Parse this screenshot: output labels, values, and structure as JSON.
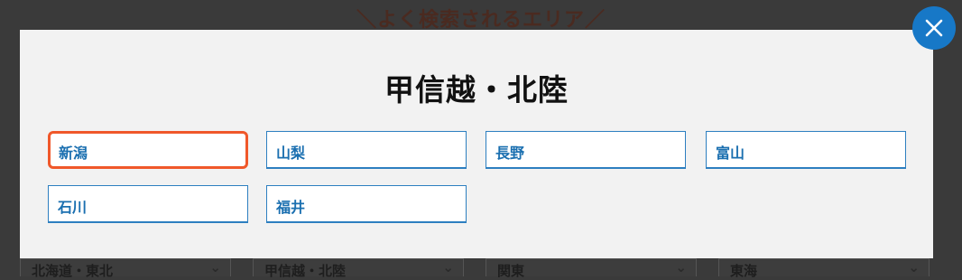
{
  "background": {
    "heading": "＼よく検索されるエリア／",
    "tabs": [
      {
        "label": "北海道・東北"
      },
      {
        "label": "甲信越・北陸"
      },
      {
        "label": "関東"
      },
      {
        "label": "東海"
      }
    ]
  },
  "modal": {
    "title": "甲信越・北陸",
    "areas": [
      {
        "label": "新潟",
        "selected": true
      },
      {
        "label": "山梨"
      },
      {
        "label": "長野"
      },
      {
        "label": "富山"
      },
      {
        "label": "石川"
      },
      {
        "label": "福井"
      }
    ],
    "close_icon": "close-icon"
  },
  "colors": {
    "accent": "#1778c7",
    "selected_outline": "#f0582a",
    "link_text": "#1a6fb0"
  }
}
